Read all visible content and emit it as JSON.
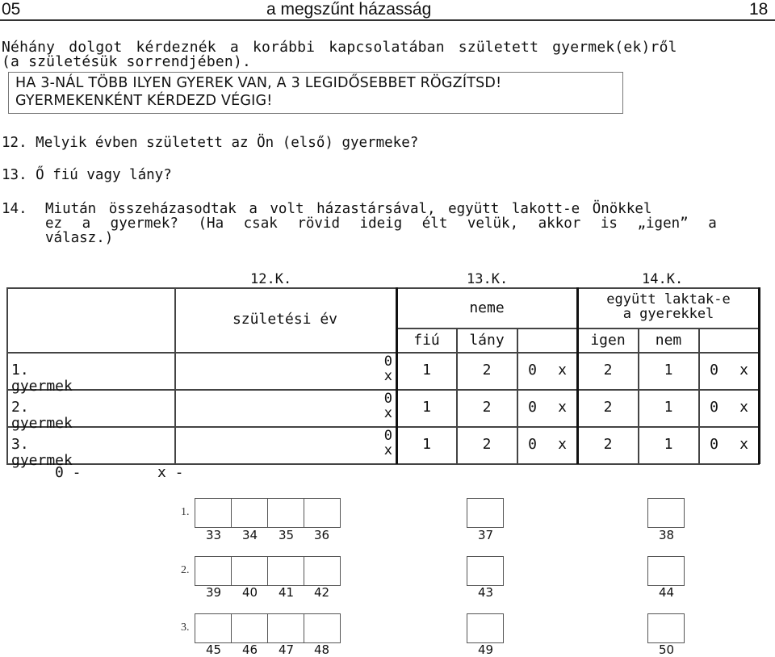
{
  "header": {
    "section_code": "05",
    "title": "a megszűnt házasság",
    "page_number": "18"
  },
  "intro": {
    "line1": "Néhány dolgot kérdeznék a korábbi kapcsolatában született gyermek(ek)ről",
    "line2": "(a születésük sorrendjében)."
  },
  "instruction_box": {
    "line1": "HA 3-NÁL TÖBB ILYEN GYEREK VAN, A 3 LEGIDŐSEBBET RÖGZÍTSD!",
    "line2": "GYERMEKENKÉNT KÉRDEZD VÉGIG!"
  },
  "questions": [
    {
      "number": "12.",
      "text": "Melyik évben született az Ön (első) gyermeke?"
    },
    {
      "number": "13.",
      "text": "Ő fiú vagy lány?"
    },
    {
      "number": "14.",
      "lines": [
        "Miután összeházasodtak a volt házastársával, együtt lakott-e Önökkel",
        "ez a gyermek? (Ha csak rövid ideig élt velük, akkor is „igen” a",
        "válasz.)"
      ]
    }
  ],
  "table": {
    "question_codes": [
      "12.K.",
      "13.K.",
      "14.K."
    ],
    "headers": {
      "birth_year": "születési év",
      "sex": "neme",
      "lived_together_line1": "együtt laktak-e",
      "lived_together_line2": "a gyerekkel"
    },
    "subheaders": {
      "boy": "fiú",
      "girl": "lány",
      "yes": "igen",
      "no": "nem"
    },
    "rows": [
      {
        "label": "1. gyermek",
        "year_codes": [
          "0",
          "x"
        ],
        "sex_values": [
          "1",
          "2",
          "0",
          "x"
        ],
        "lived_values": [
          "2",
          "1",
          "0",
          "x"
        ]
      },
      {
        "label": "2. gyermek",
        "year_codes": [
          "0",
          "x"
        ],
        "sex_values": [
          "1",
          "2",
          "0",
          "x"
        ],
        "lived_values": [
          "2",
          "1",
          "0",
          "x"
        ]
      },
      {
        "label": "3. gyermek",
        "year_codes": [
          "0",
          "x"
        ],
        "sex_values": [
          "1",
          "2",
          "0",
          "x"
        ],
        "lived_values": [
          "2",
          "1",
          "0",
          "x"
        ]
      }
    ],
    "legend": {
      "zero": "0 -",
      "x": "x -"
    }
  },
  "coding_grid": {
    "rows": [
      {
        "label": "1.",
        "year_boxes": [
          "33",
          "34",
          "35",
          "36"
        ],
        "sex_box": "37",
        "lived_box": "38"
      },
      {
        "label": "2.",
        "year_boxes": [
          "39",
          "40",
          "41",
          "42"
        ],
        "sex_box": "43",
        "lived_box": "44"
      },
      {
        "label": "3.",
        "year_boxes": [
          "45",
          "46",
          "47",
          "48"
        ],
        "sex_box": "49",
        "lived_box": "50"
      }
    ]
  }
}
